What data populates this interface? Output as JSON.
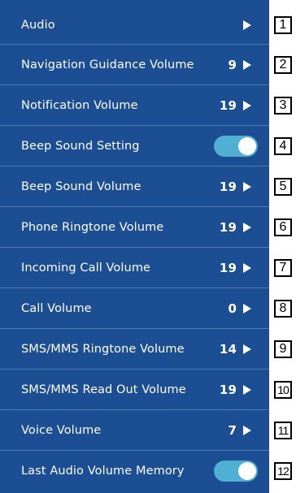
{
  "rows": [
    {
      "label": "Audio",
      "value": "",
      "control": "arrow",
      "badge": "1"
    },
    {
      "label": "Navigation Guidance Volume",
      "value": "9",
      "control": "arrow",
      "badge": "2"
    },
    {
      "label": "Notification Volume",
      "value": "19",
      "control": "arrow",
      "badge": "3"
    },
    {
      "label": "Beep Sound Setting",
      "value": "",
      "control": "toggle",
      "toggle_on": true,
      "badge": "4"
    },
    {
      "label": "Beep Sound Volume",
      "value": "19",
      "control": "arrow",
      "badge": "5"
    },
    {
      "label": "Phone Ringtone Volume",
      "value": "19",
      "control": "arrow",
      "badge": "6"
    },
    {
      "label": "Incoming Call Volume",
      "value": "19",
      "control": "arrow",
      "badge": "7"
    },
    {
      "label": "Call Volume",
      "value": "0",
      "control": "arrow",
      "badge": "8"
    },
    {
      "label": "SMS/MMS Ringtone Volume",
      "value": "14",
      "control": "arrow",
      "badge": "9"
    },
    {
      "label": "SMS/MMS Read Out Volume",
      "value": "19",
      "control": "arrow",
      "badge": "10"
    },
    {
      "label": "Voice Volume",
      "value": "7",
      "control": "arrow",
      "badge": "11"
    },
    {
      "label": "Last Audio Volume Memory",
      "value": "",
      "control": "toggle",
      "toggle_on": true,
      "badge": "12"
    }
  ],
  "colors": {
    "background": "#1c4e93",
    "divider": "#4f79b3",
    "toggle_on": "#4fb0d3",
    "text": "#ffffff"
  }
}
